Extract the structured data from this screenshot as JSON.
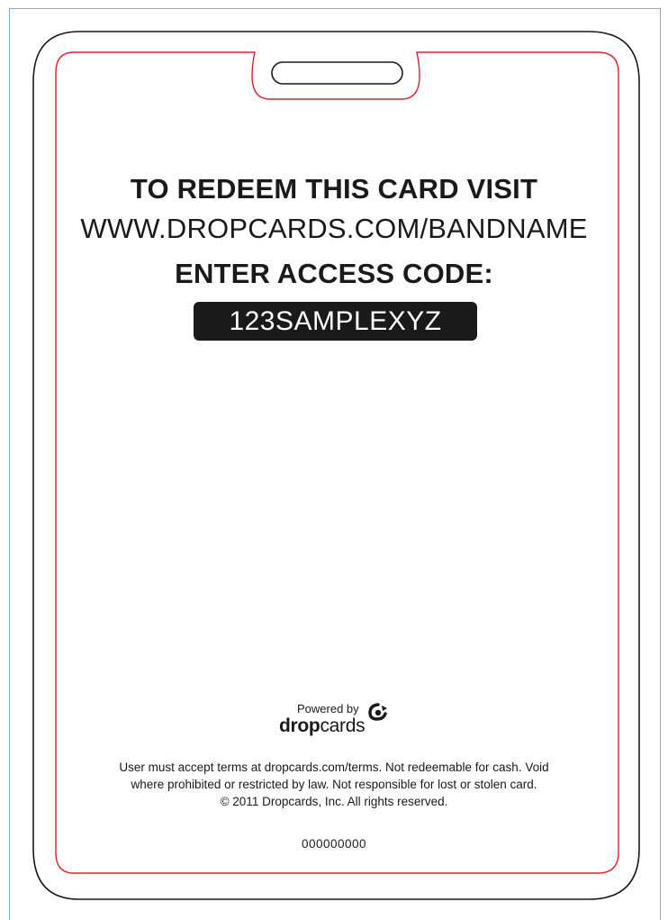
{
  "card": {
    "headline": "TO REDEEM THIS CARD VISIT",
    "url": "WWW.DROPCARDS.COM/BANDNAME",
    "enter_code": "ENTER ACCESS CODE:",
    "access_code": "123SAMPLEXYZ"
  },
  "branding": {
    "powered_by": "Powered by",
    "brand_bold": "drop",
    "brand_light": "cards",
    "logo_icon": "dropcards-logo-icon"
  },
  "legal": {
    "line1": "User must accept terms at dropcards.com/terms. Not redeemable for cash.  Void",
    "line2": "where prohibited or restricted by law. Not responsible for lost or stolen card.",
    "line3": "© 2011 Dropcards, Inc.  All rights reserved."
  },
  "serial_number": "000000000",
  "colors": {
    "outer_border": "#1a1a1a",
    "cut_line": "#e0202a",
    "page_guide": "#7ab4d8",
    "text": "#1a1a1a"
  }
}
